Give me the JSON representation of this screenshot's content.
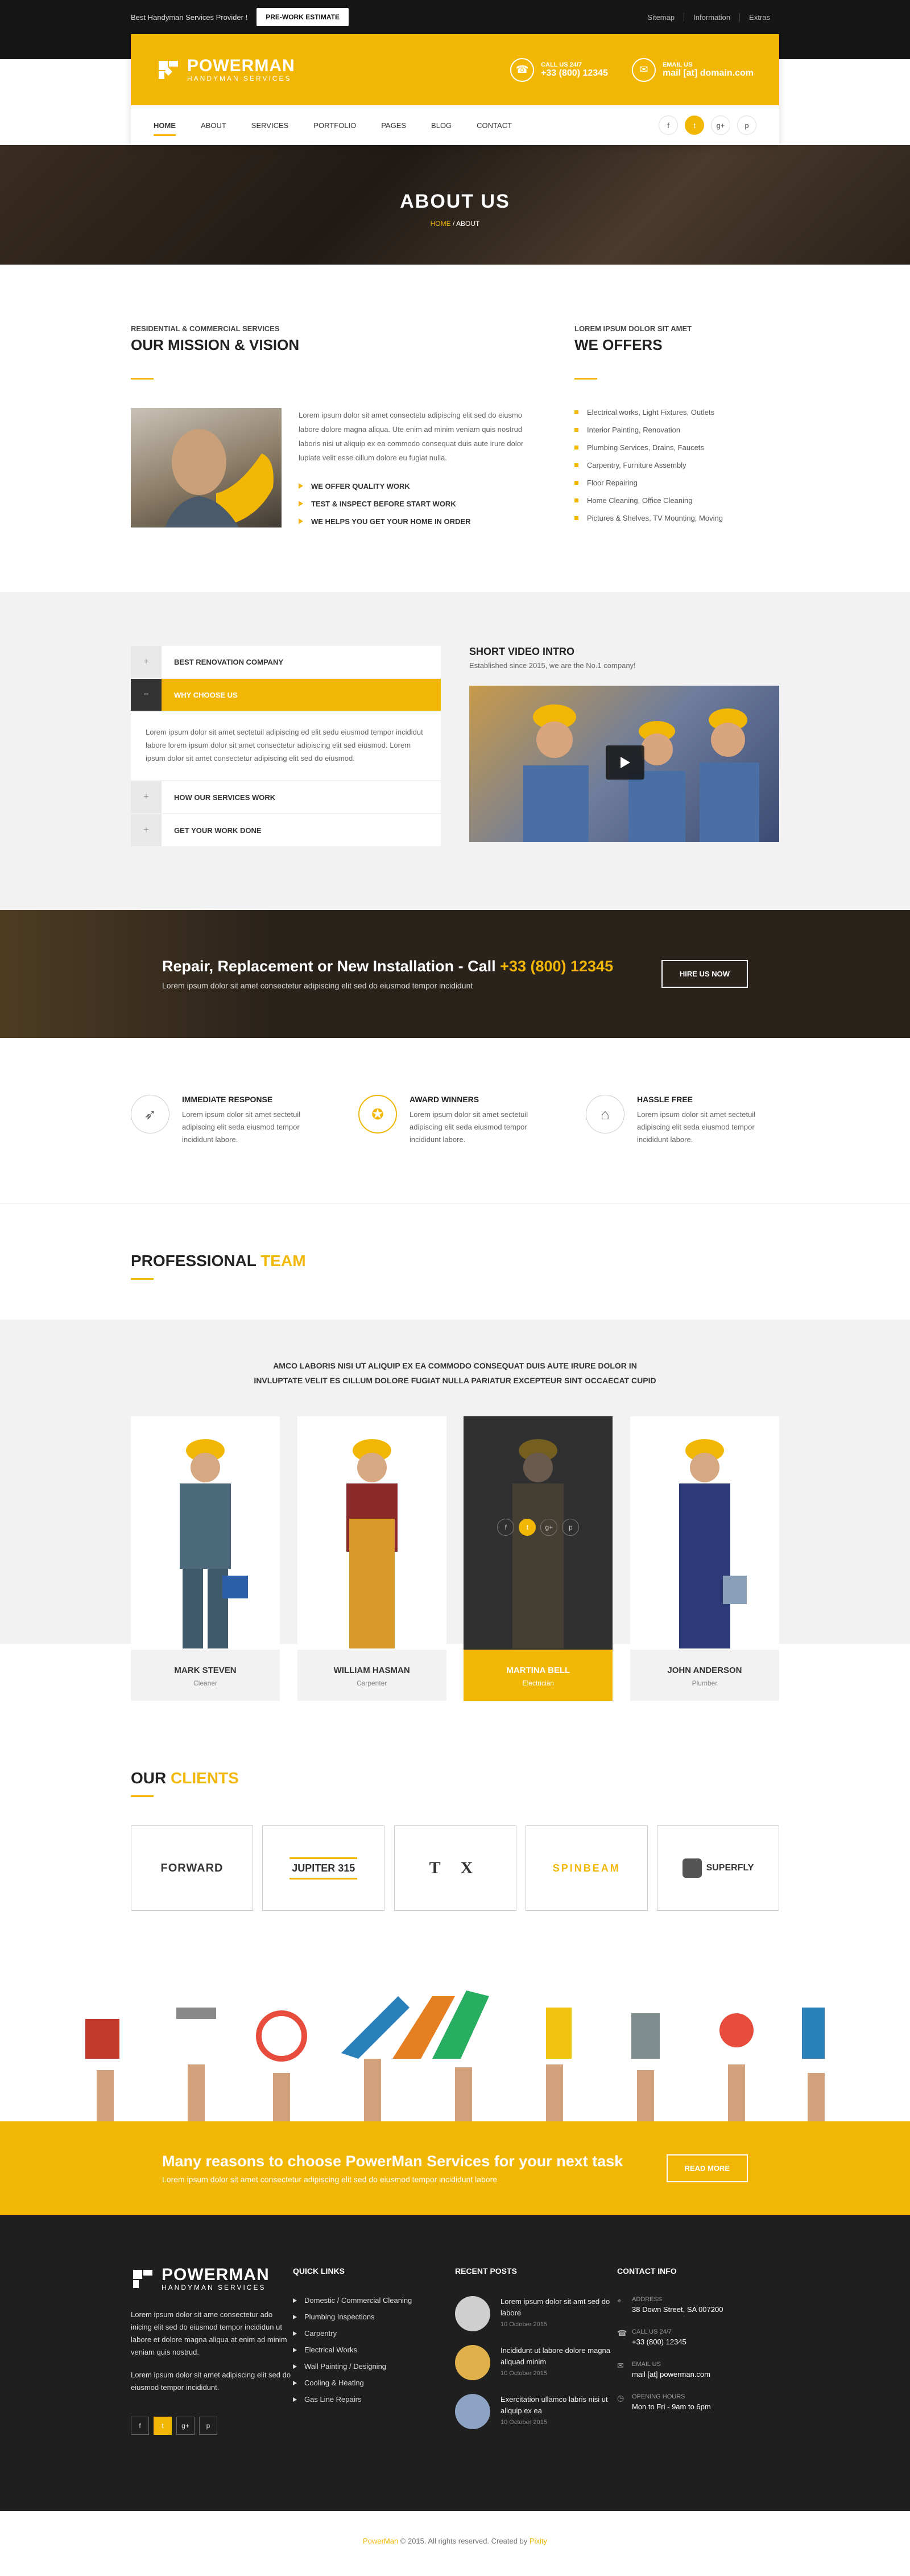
{
  "topbar": {
    "tagline": "Best Handyman Services Provider !",
    "estimate_button": "PRE-WORK ESTIMATE",
    "links": [
      "Sitemap",
      "Information",
      "Extras"
    ]
  },
  "header": {
    "brand": "POWERMAN",
    "brand_sub": "HANDYMAN SERVICES",
    "call_label": "CALL US 24/7",
    "call_value": "+33 (800) 12345",
    "email_label": "EMAIL US",
    "email_value": "mail [at] domain.com"
  },
  "nav": {
    "items": [
      "HOME",
      "ABOUT",
      "SERVICES",
      "PORTFOLIO",
      "PAGES",
      "BLOG",
      "CONTACT"
    ],
    "social": [
      "f",
      "t",
      "g+",
      "p"
    ]
  },
  "hero": {
    "title": "ABOUT US",
    "crumb_home": "HOME",
    "crumb_sep": "/",
    "crumb_current": "ABOUT"
  },
  "mission": {
    "kicker": "RESIDENTIAL & COMMERCIAL SERVICES",
    "title": "OUR MISSION & VISION",
    "text": "Lorem ipsum dolor sit amet consectetu adipiscing elit sed do eiusmo labore dolore magna aliqua. Ute enim ad minim veniam quis nostrud laboris nisi ut aliquip ex ea commodo consequat duis aute irure dolor lupiate velit esse cillum dolore eu fugiat nulla.",
    "points": [
      "WE OFFER QUALITY WORK",
      "TEST & INSPECT BEFORE START WORK",
      "WE HELPS YOU GET YOUR HOME IN ORDER"
    ]
  },
  "offers": {
    "kicker": "LOREM IPSUM DOLOR SIT AMET",
    "title": "WE OFFERS",
    "items": [
      "Electrical works, Light Fixtures, Outlets",
      "Interior Painting, Renovation",
      "Plumbing Services, Drains, Faucets",
      "Carpentry, Furniture Assembly",
      "Floor Repairing",
      "Home Cleaning, Office Cleaning",
      "Pictures & Shelves, TV Mounting, Moving"
    ]
  },
  "accordion": {
    "items": [
      "BEST RENOVATION COMPANY",
      "WHY CHOOSE US",
      "HOW OUR SERVICES WORK",
      "GET YOUR WORK DONE"
    ],
    "panel": "Lorem ipsum dolor sit amet sectetuil adipiscing ed elit sedu eiusmod tempor incididut labore lorem ipsum dolor sit amet consectetur adipiscing elit sed eiusmod. Lorem ipsum dolor sit amet consectetur adipiscing elit sed do eiusmod."
  },
  "video": {
    "title": "SHORT VIDEO INTRO",
    "subtitle": "Established since 2015, we are the No.1 company!"
  },
  "cta": {
    "title_prefix": "Repair, Replacement or New Installation - Call ",
    "phone": "+33 (800) 12345",
    "text": "Lorem ipsum dolor sit amet consectetur adipiscing elit sed do eiusmod tempor incididunt",
    "button": "HIRE US NOW"
  },
  "features": [
    {
      "icon": "rocket-icon",
      "title": "IMMEDIATE RESPONSE",
      "text": "Lorem ipsum dolor sit amet sectetuil adipiscing elit seda eiusmod tempor incididunt labore."
    },
    {
      "icon": "award-icon",
      "title": "AWARD WINNERS",
      "text": "Lorem ipsum dolor sit amet sectetuil adipiscing elit seda eiusmod tempor incididunt labore."
    },
    {
      "icon": "home-icon",
      "title": "HASSLE FREE",
      "text": "Lorem ipsum dolor sit amet sectetuil adipiscing elit seda eiusmod tempor incididunt labore."
    }
  ],
  "team": {
    "title_a": "PROFESSIONAL ",
    "title_b": "TEAM",
    "intro_line1": "AMCO LABORIS NISI UT ALIQUIP EX EA COMMODO CONSEQUAT DUIS AUTE IRURE DOLOR IN",
    "intro_line2": "INVLUPTATE VELIT ES CILLUM DOLORE FUGIAT NULLA PARIATUR EXCEPTEUR SINT OCCAECAT CUPID",
    "members": [
      {
        "name": "MARK STEVEN",
        "role": "Cleaner"
      },
      {
        "name": "WILLIAM HASMAN",
        "role": "Carpenter"
      },
      {
        "name": "MARTINA BELL",
        "role": "Electrician"
      },
      {
        "name": "JOHN ANDERSON",
        "role": "Plumber"
      }
    ]
  },
  "clients": {
    "title_a": "OUR ",
    "title_b": "CLIENTS",
    "logos": [
      "FORWARD",
      "JUPITER 315",
      "T X",
      "SPINBEAM",
      "SUPERFLY"
    ]
  },
  "banner": {
    "title": "Many reasons to choose PowerMan Services for your next task",
    "text": "Lorem ipsum dolor sit amet consectetur adipiscing elit sed do eiusmod tempor incididunt labore",
    "button": "READ MORE"
  },
  "footer": {
    "about1": "Lorem ipsum dolor sit ame consectetur ado inicing elit sed do eiusmod tempor incididun ut labore et dolore magna aliqua at enim ad minim veniam quis nostrud.",
    "about2": "Lorem ipsum dolor sit amet adipiscing elit sed do eiusmod tempor incididunt.",
    "social": [
      "f",
      "t",
      "g+",
      "p"
    ],
    "quick_title": "QUICK LINKS",
    "quick": [
      "Domestic / Commercial Cleaning",
      "Plumbing Inspections",
      "Carpentry",
      "Electrical Works",
      "Wall Painting / Designing",
      "Cooling & Heating",
      "Gas Line Repairs"
    ],
    "posts_title": "RECENT POSTS",
    "posts": [
      {
        "text": "Lorem ipsum dolor sit amt sed do labore",
        "date": "10 October 2015"
      },
      {
        "text": "Incididunt ut labore dolore magna aliquad minim",
        "date": "10 October 2015"
      },
      {
        "text": "Exercitation ullamco labris nisi ut aliquip ex ea",
        "date": "10 October 2015"
      }
    ],
    "contact_title": "CONTACT INFO",
    "contact": [
      {
        "label": "ADDRESS",
        "value": "38 Down Street, SA 007200"
      },
      {
        "label": "CALL US 24/7",
        "value": "+33 (800) 12345"
      },
      {
        "label": "EMAIL US",
        "value": "mail [at] powerman.com"
      },
      {
        "label": "OPENING HOURS",
        "value": "Mon to Fri - 9am to 6pm"
      }
    ]
  },
  "copyright": {
    "brand": "PowerMan",
    "text": " © 2015. All rights reserved. Created by ",
    "author": "Pixity"
  },
  "colors": {
    "accent": "#f2b705",
    "dark": "#1f1f1f"
  }
}
